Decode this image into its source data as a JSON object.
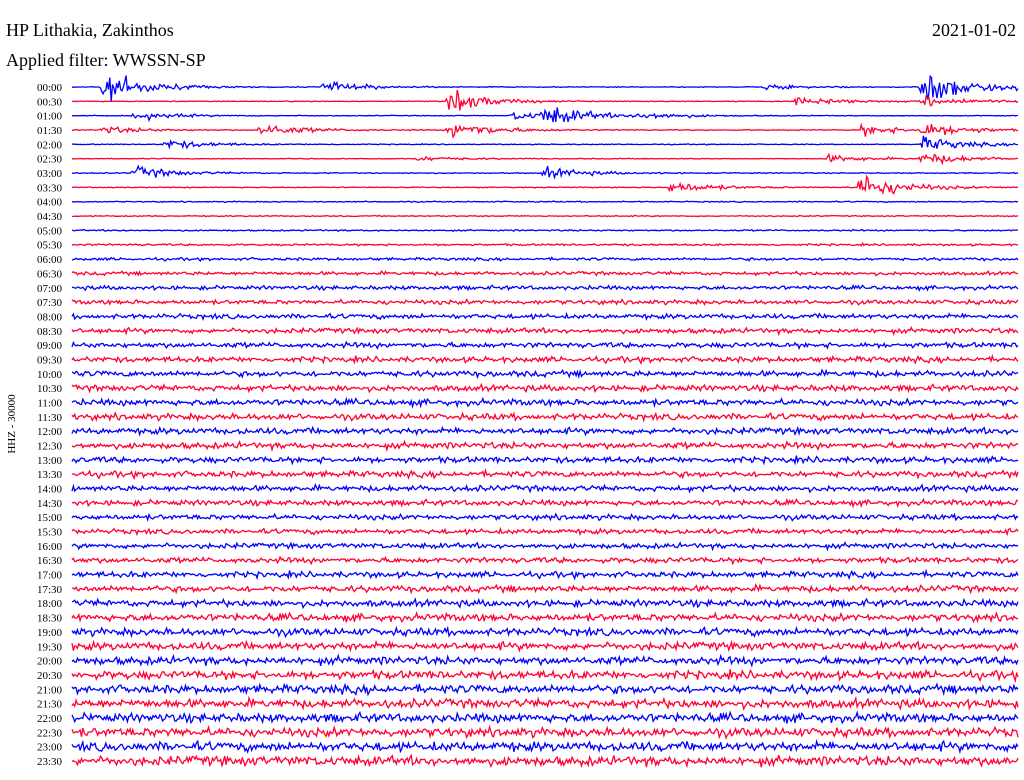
{
  "header": {
    "station": "HP Lithakia, Zakinthos",
    "filter": "Applied filter: WWSSN-SP",
    "date": "2021-01-02"
  },
  "chart_data": {
    "type": "line",
    "title": "HP Lithakia, Zakinthos",
    "ylabel": "HHZ - 30000",
    "date": "2021-01-02",
    "filter": "WWSSN-SP",
    "row_interval_minutes": 30,
    "row_labels": [
      "00:00",
      "00:30",
      "01:00",
      "01:30",
      "02:00",
      "02:30",
      "03:00",
      "03:30",
      "04:00",
      "04:30",
      "05:00",
      "05:30",
      "06:00",
      "06:30",
      "07:00",
      "07:30",
      "08:00",
      "08:30",
      "09:00",
      "09:30",
      "10:00",
      "10:30",
      "11:00",
      "11:30",
      "12:00",
      "12:30",
      "13:00",
      "13:30",
      "14:00",
      "14:30",
      "15:00",
      "15:30",
      "16:00",
      "16:30",
      "17:00",
      "17:30",
      "18:00",
      "18:30",
      "19:00",
      "19:30",
      "20:00",
      "20:30",
      "21:00",
      "21:30",
      "22:00",
      "22:30",
      "23:00",
      "23:30"
    ],
    "row_noise_level": [
      0.6,
      0.6,
      0.6,
      0.7,
      0.7,
      0.7,
      0.8,
      0.8,
      0.9,
      0.9,
      1.2,
      1.6,
      2.2,
      2.8,
      3.2,
      3.5,
      3.8,
      4.0,
      4.2,
      4.4,
      4.6,
      4.8,
      5.0,
      5.0,
      5.0,
      5.0,
      4.8,
      4.8,
      4.6,
      4.4,
      4.2,
      4.0,
      4.2,
      4.4,
      4.6,
      5.0,
      5.4,
      5.8,
      6.0,
      6.2,
      6.4,
      6.6,
      6.8,
      7.0,
      7.0,
      7.2,
      7.4,
      7.6
    ],
    "colors": [
      "#0000ff",
      "#ff0033"
    ],
    "events": [
      {
        "row": 0,
        "minute": 8,
        "amp": 9
      },
      {
        "row": 2,
        "minute": 14,
        "amp": 7
      },
      {
        "row": 0,
        "minute": 30,
        "amp": 5
      },
      {
        "row": 3,
        "minute": 1,
        "amp": 6
      },
      {
        "row": 4,
        "minute": 3,
        "amp": 8
      },
      {
        "row": 6,
        "minute": 2,
        "amp": 10
      },
      {
        "row": 5,
        "minute": 24,
        "amp": 6
      },
      {
        "row": 7,
        "minute": 25,
        "amp": 22
      },
      {
        "row": 1,
        "minute": 12,
        "amp": 18
      },
      {
        "row": 2,
        "minute": 15,
        "amp": 16
      },
      {
        "row": 3,
        "minute": 12,
        "amp": 16
      },
      {
        "row": 6,
        "minute": 15,
        "amp": 9
      },
      {
        "row": 5,
        "minute": 11,
        "amp": 4
      },
      {
        "row": 3,
        "minute": 27,
        "amp": 12
      },
      {
        "row": 2,
        "minute": 18,
        "amp": 6
      },
      {
        "row": 0,
        "minute": 27,
        "amp": 20
      },
      {
        "row": 1,
        "minute": 27,
        "amp": 10
      },
      {
        "row": 7,
        "minute": 19,
        "amp": 10
      },
      {
        "row": 2,
        "minute": 2,
        "amp": 7
      },
      {
        "row": 0,
        "minute": 22,
        "amp": 4
      },
      {
        "row": 3,
        "minute": 6,
        "amp": 11
      },
      {
        "row": 0,
        "minute": 1,
        "amp": 26
      },
      {
        "row": 1,
        "minute": 23,
        "amp": 9
      },
      {
        "row": 4,
        "minute": 27,
        "amp": 12
      },
      {
        "row": 5,
        "minute": 27,
        "amp": 10
      },
      {
        "row": 0,
        "minute": 27,
        "amp": 9
      },
      {
        "row": 3,
        "minute": 25,
        "amp": 9
      },
      {
        "row": 0,
        "minute": 28,
        "amp": 5
      }
    ],
    "gridlines": false
  }
}
